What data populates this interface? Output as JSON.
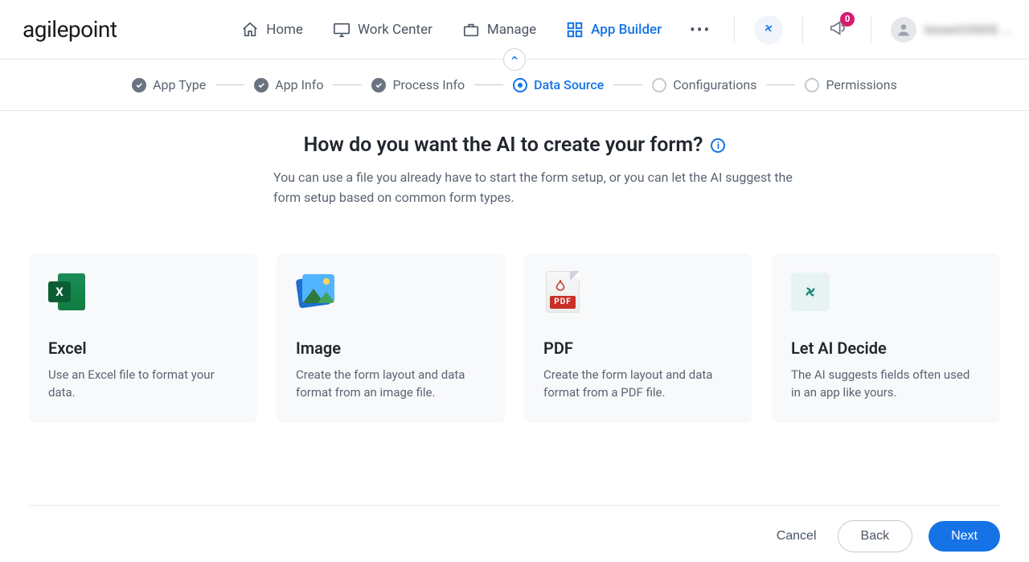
{
  "logo": "agilepoint",
  "nav": {
    "home": "Home",
    "work_center": "Work Center",
    "manage": "Manage",
    "app_builder": "App Builder"
  },
  "notifications": {
    "count": "0"
  },
  "user": {
    "name": "tenant2000$ ..."
  },
  "steps": {
    "app_type": "App Type",
    "app_info": "App Info",
    "process_info": "Process Info",
    "data_source": "Data Source",
    "configurations": "Configurations",
    "permissions": "Permissions"
  },
  "page": {
    "title": "How do you want the AI to create your form?",
    "subtitle": "You can use a file you already have to start the form setup, or you can let the AI suggest the form setup based on common form types."
  },
  "cards": {
    "excel": {
      "title": "Excel",
      "desc": "Use an Excel file to format your data."
    },
    "image": {
      "title": "Image",
      "desc": "Create the form layout and data format from an image file."
    },
    "pdf": {
      "title": "PDF",
      "desc": "Create the form layout and data format from a PDF file."
    },
    "ai": {
      "title": "Let AI Decide",
      "desc": "The AI suggests fields often used in an app like yours."
    }
  },
  "footer": {
    "cancel": "Cancel",
    "back": "Back",
    "next": "Next"
  },
  "pdf_label": "PDF"
}
